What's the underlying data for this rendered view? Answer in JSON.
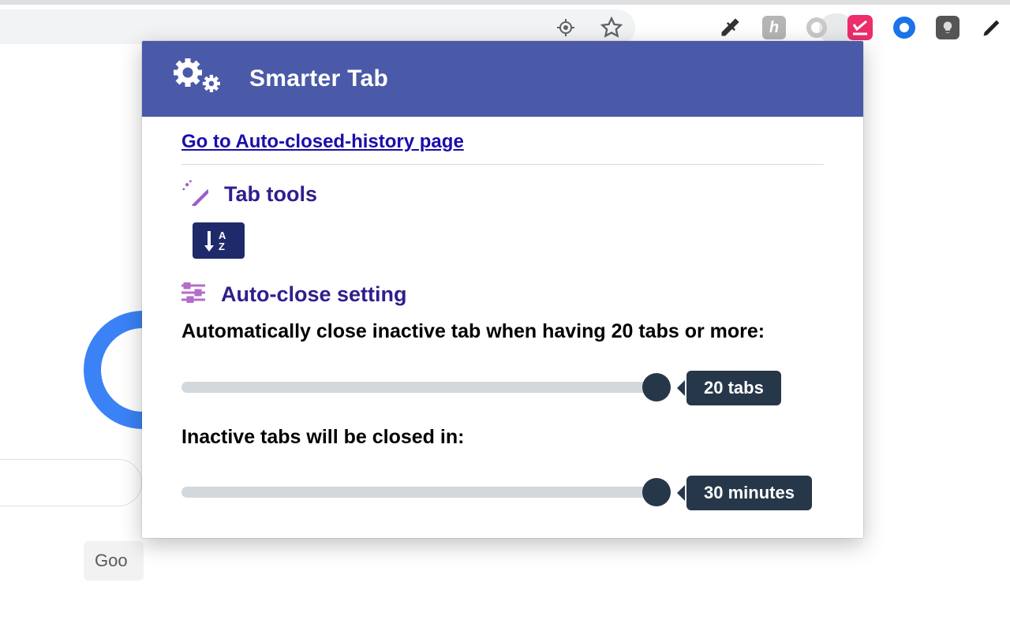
{
  "toolbar": {
    "extensions": {
      "h_label": "h"
    }
  },
  "background": {
    "button_fragment": "Goo"
  },
  "popup": {
    "title": "Smarter Tab",
    "history_link": "Go to Auto-closed-history page",
    "tab_tools": {
      "title": "Tab tools",
      "sort_a": "A",
      "sort_z": "Z"
    },
    "auto_close": {
      "title": "Auto-close setting",
      "description": "Automatically close inactive tab when having 20 tabs or more:",
      "slider1": {
        "value_label": "20 tabs",
        "thumb_pct": 0.95
      },
      "sub_label": "Inactive tabs will be closed in:",
      "slider2": {
        "value_label": "30 minutes",
        "thumb_pct": 0.95
      }
    }
  }
}
